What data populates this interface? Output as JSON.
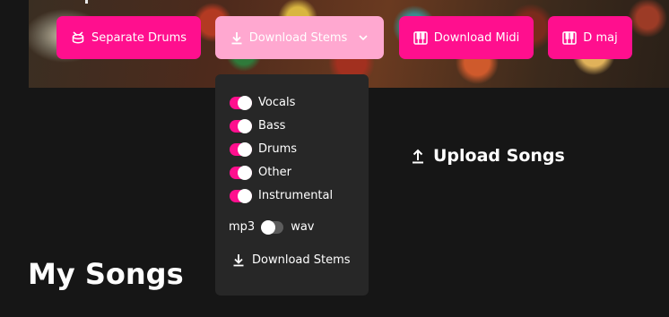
{
  "toolbar": {
    "separate_drums": "Separate Drums",
    "download_stems": "Download Stems",
    "download_midi": "Download Midi",
    "key": "D maj"
  },
  "stems_menu": {
    "options": [
      {
        "label": "Vocals",
        "enabled": true
      },
      {
        "label": "Bass",
        "enabled": true
      },
      {
        "label": "Drums",
        "enabled": true
      },
      {
        "label": "Other",
        "enabled": true
      },
      {
        "label": "Instrumental",
        "enabled": true
      }
    ],
    "format": {
      "left_label": "mp3",
      "right_label": "wav",
      "selected": "mp3"
    },
    "download_label": "Download Stems"
  },
  "upload_label": "Upload Songs",
  "section_title": "My Songs",
  "colors": {
    "accent": "#ff0f8e",
    "accent_light": "#ffa8d0",
    "background": "#161616",
    "menu_bg": "#272727"
  },
  "icons": {
    "separate": "drum-icon",
    "download": "download-icon",
    "chevron": "chevron-down-icon",
    "piano": "piano-icon",
    "upload": "upload-icon"
  }
}
